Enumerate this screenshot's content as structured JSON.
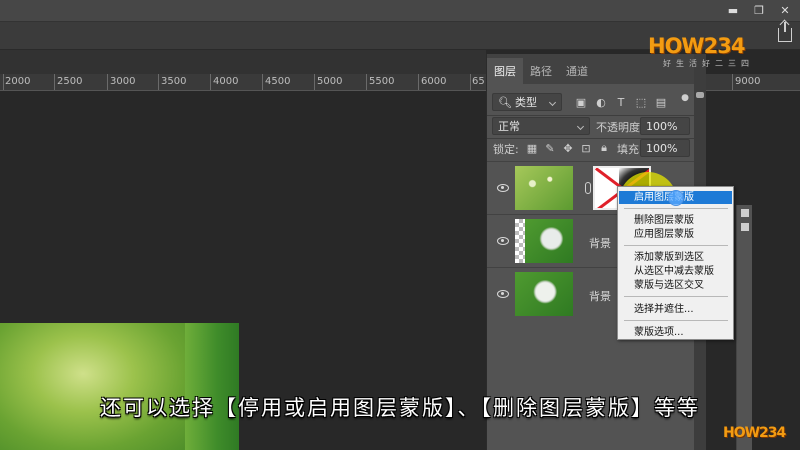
{
  "window": {
    "controls": [
      "▬",
      "❐",
      "✕"
    ]
  },
  "ruler": {
    "labels": [
      "2000",
      "2500",
      "3000",
      "3500",
      "4000",
      "4500",
      "5000",
      "5500",
      "6000",
      "65",
      "9000"
    ]
  },
  "layers_panel": {
    "tabs": [
      {
        "label": "图层",
        "active": true
      },
      {
        "label": "路径",
        "active": false
      },
      {
        "label": "通道",
        "active": false
      }
    ],
    "filter_label": "类型",
    "blend_mode": "正常",
    "opacity_label": "不透明度:",
    "opacity_value": "100%",
    "lock_label": "锁定:",
    "fill_label": "填充:",
    "fill_value": "100%",
    "layers": [
      {
        "name": ""
      },
      {
        "name": "背景"
      },
      {
        "name": "背景"
      }
    ]
  },
  "context_menu": {
    "items": [
      {
        "label": "启用图层蒙版",
        "active": true
      },
      {
        "label": "删除图层蒙版"
      },
      {
        "label": "应用图层蒙版"
      },
      {
        "label": "添加蒙版到选区"
      },
      {
        "label": "从选区中减去蒙版"
      },
      {
        "label": "蒙版与选区交叉"
      },
      {
        "label": "选择并遮住..."
      },
      {
        "label": "蒙版选项..."
      }
    ]
  },
  "watermark": {
    "top": "HOW234",
    "sub": "好生活好二三四",
    "bottom": "HOW234"
  },
  "caption": "还可以选择【停用或启用图层蒙版】、【删除图层蒙版】等等",
  "colors": {
    "menu_highlight": "#1e7ad6",
    "panel_bg": "#535353",
    "canvas_bg": "#282828"
  }
}
